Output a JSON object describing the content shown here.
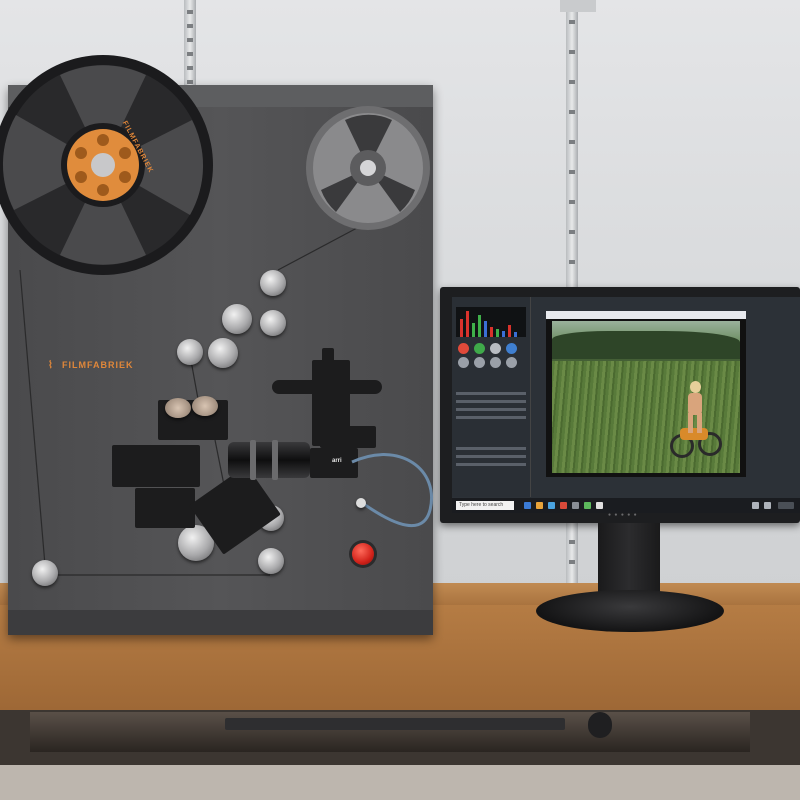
{
  "scanner": {
    "brand_label": "FILMFABRIEK",
    "brand_mark": "⌇",
    "reel_label": "FILMFABRIEK",
    "camera_label": "arri"
  },
  "software": {
    "panel_title": "",
    "taskbar_search": "Type here to search"
  },
  "colors": {
    "accent_orange": "#e0873a",
    "cabinet_gray": "#4f4f51",
    "desk_wood": "#b57c44",
    "estop_red": "#d2221a"
  }
}
